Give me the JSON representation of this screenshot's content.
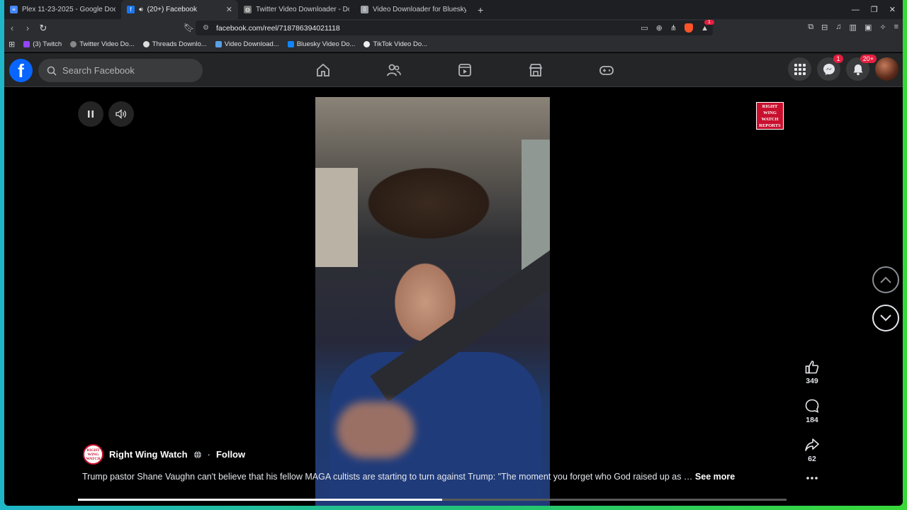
{
  "browser": {
    "tabs": [
      {
        "label": "Plex 11-23-2025 - Google Docs",
        "icon": "docs-icon",
        "color": "#4285f4",
        "active": false
      },
      {
        "label": "(20+) Facebook",
        "icon": "facebook-icon",
        "color": "#1877f2",
        "active": true
      },
      {
        "label": "Twitter Video Downloader - Do",
        "icon": "globe-icon",
        "color": "#777777",
        "active": false
      },
      {
        "label": "Video Downloader for Bluesky",
        "icon": "download-icon",
        "color": "#9aa0a6",
        "active": false
      }
    ],
    "new_tab_label": "+",
    "url": "facebook.com/reel/718786394021118",
    "bookmarks": [
      {
        "label": "(3) Twitch",
        "color": "#9146ff"
      },
      {
        "label": "Twitter Video Do...",
        "color": "#888888"
      },
      {
        "label": "Threads Downlo...",
        "color": "#dddddd"
      },
      {
        "label": "Video Download...",
        "color": "#5aa0e6"
      },
      {
        "label": "Bluesky Video Do...",
        "color": "#1185fe"
      },
      {
        "label": "TikTok Video Do...",
        "color": "#eeeeee"
      }
    ],
    "brave_badge": "1"
  },
  "facebook": {
    "search_placeholder": "Search Facebook",
    "messenger_badge": "1",
    "notifications_badge": "20+",
    "brand_color": "#0866ff"
  },
  "reel": {
    "logo_lines": [
      "RIGHT",
      "WING",
      "WATCH",
      "REPORTS"
    ],
    "author": "Right Wing Watch",
    "separator": "·",
    "follow_label": "Follow",
    "avatar_lines": [
      "RIGHT",
      "WING",
      "WATCH"
    ],
    "caption": "Trump pastor Shane Vaughn can't believe that his fellow MAGA cultists are starting to turn against Trump: \"The moment you forget who God raised up as …",
    "see_more_label": "See more",
    "likes": "349",
    "comments": "184",
    "shares": "62",
    "progress": 0.514
  }
}
